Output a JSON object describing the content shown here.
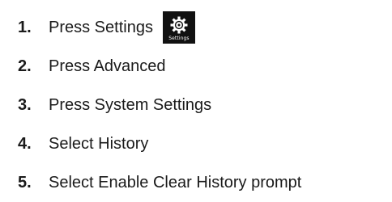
{
  "steps": [
    {
      "number": "1.",
      "text": "Press Settings",
      "icon": "settings-gear-icon",
      "icon_caption": "Settings"
    },
    {
      "number": "2.",
      "text": "Press Advanced"
    },
    {
      "number": "3.",
      "text": "Press System Settings"
    },
    {
      "number": "4.",
      "text": "Select History"
    },
    {
      "number": "5.",
      "text": "Select Enable Clear History prompt"
    }
  ],
  "colors": {
    "text": "#1a1a1a",
    "icon_background": "#111111",
    "icon_foreground": "#ffffff"
  }
}
